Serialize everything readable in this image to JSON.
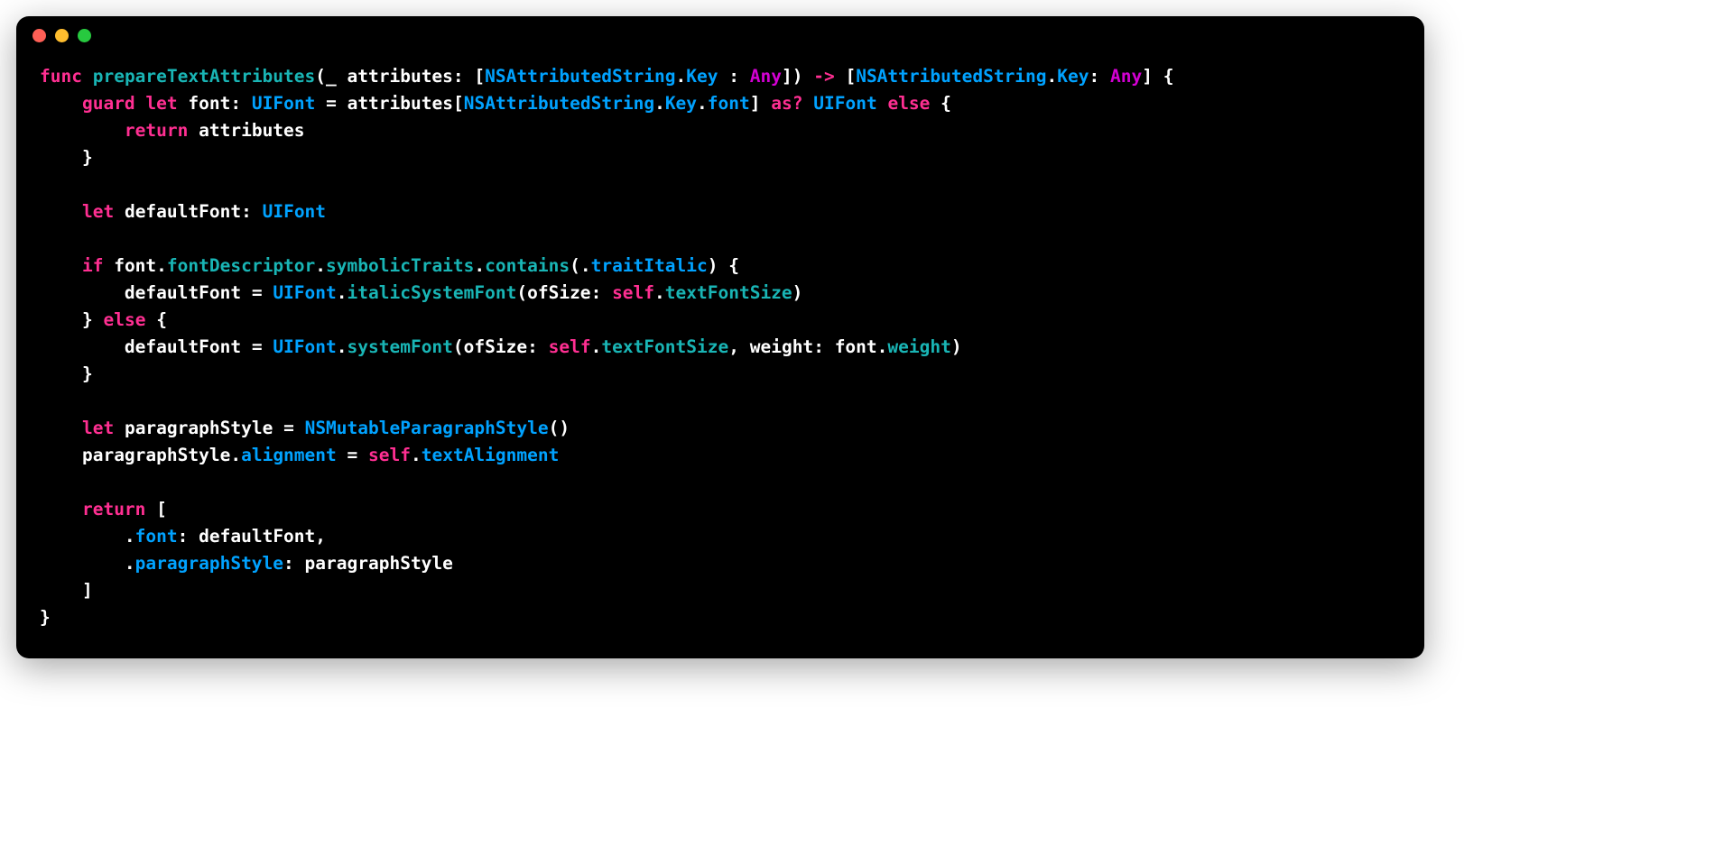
{
  "traffic": {
    "red": "#ff5f56",
    "yellow": "#ffbd2e",
    "green": "#27c93f"
  },
  "t": {
    "func": "func",
    "guard": "guard",
    "let": "let",
    "return": "return",
    "if": "if",
    "else": "else",
    "asq": "as?",
    "arrow": "->",
    "self": "self",
    "fn": "prepareTextAttributes",
    "us": "_",
    "attributes": "attributes",
    "NSAttributedString": "NSAttributedString",
    "Key": "Key",
    "Any": "Any",
    "font": "font",
    "UIFont": "UIFont",
    "defaultFont": "defaultFont",
    "fontDescriptor": "fontDescriptor",
    "symbolicTraits": "symbolicTraits",
    "contains": "contains",
    "traitItalic": "traitItalic",
    "italicSystemFont": "italicSystemFont",
    "systemFont": "systemFont",
    "ofSize": "ofSize",
    "textFontSize": "textFontSize",
    "weight": "weight",
    "paragraphStyle": "paragraphStyle",
    "NSMutableParagraphStyle": "NSMutableParagraphStyle",
    "alignment": "alignment",
    "textAlignment": "textAlignment",
    "op": "(",
    "cp": ")",
    "ob": "[",
    "cb": "]",
    "oc": "{",
    "cc": "}",
    "colon": ":",
    "comma": ",",
    "eq": "=",
    "dot": ".",
    "sp": " "
  }
}
